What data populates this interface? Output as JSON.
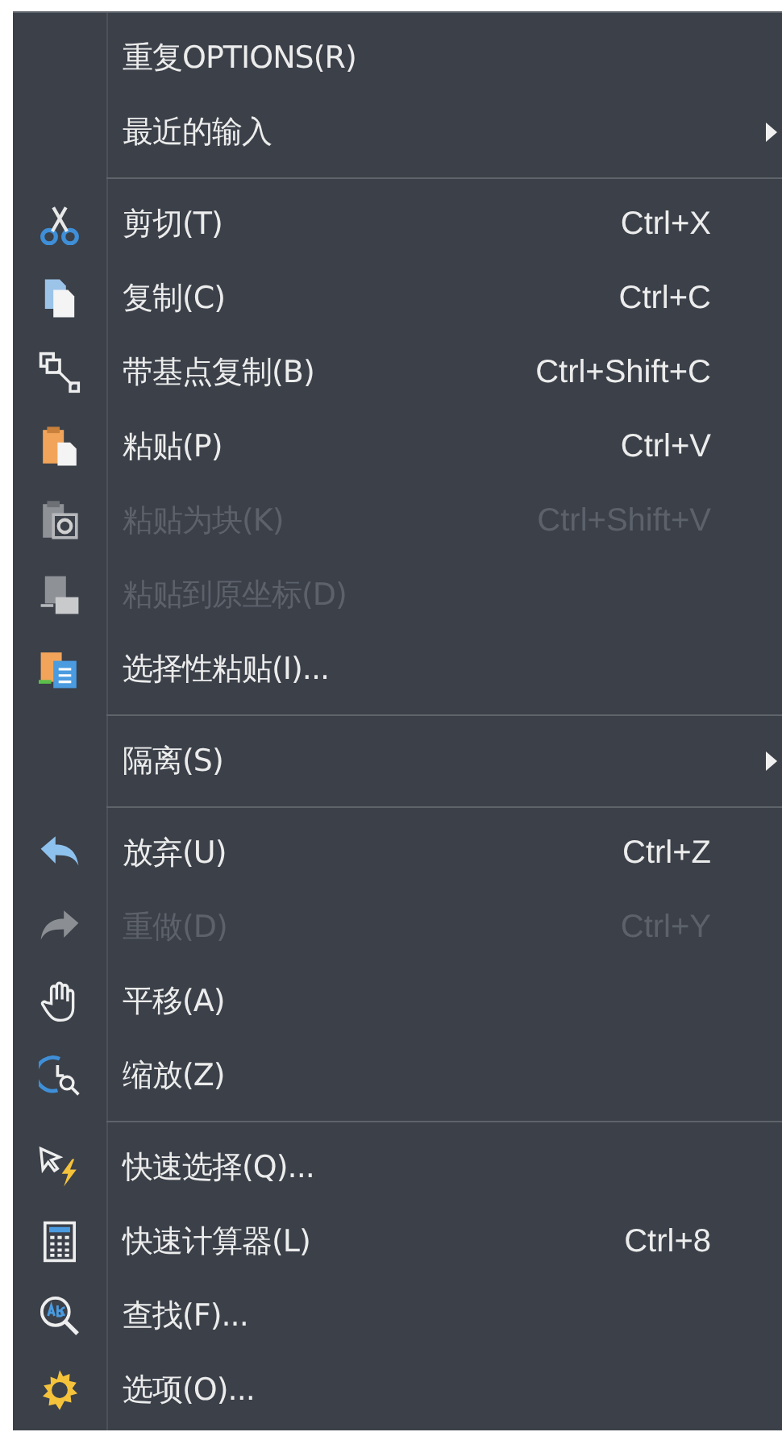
{
  "context_menu": {
    "sections": [
      {
        "items": [
          {
            "label": "重复OPTIONS(R)",
            "disabled": false,
            "submenu": false
          },
          {
            "label": "最近的输入",
            "disabled": false,
            "submenu": true
          }
        ]
      },
      {
        "items": [
          {
            "label": "剪切(T)",
            "shortcut": "Ctrl+X",
            "disabled": false,
            "submenu": false
          },
          {
            "label": "复制(C)",
            "shortcut": "Ctrl+C",
            "disabled": false,
            "submenu": false
          },
          {
            "label": "带基点复制(B)",
            "shortcut": "Ctrl+Shift+C",
            "disabled": false,
            "submenu": false
          },
          {
            "label": "粘贴(P)",
            "shortcut": "Ctrl+V",
            "disabled": false,
            "submenu": false
          },
          {
            "label": "粘贴为块(K)",
            "shortcut": "Ctrl+Shift+V",
            "disabled": true,
            "submenu": false
          },
          {
            "label": "粘贴到原坐标(D)",
            "disabled": true,
            "submenu": false
          },
          {
            "label": "选择性粘贴(I)...",
            "disabled": false,
            "submenu": false
          }
        ]
      },
      {
        "items": [
          {
            "label": "隔离(S)",
            "disabled": false,
            "submenu": true
          }
        ]
      },
      {
        "items": [
          {
            "label": "放弃(U)",
            "shortcut": "Ctrl+Z",
            "disabled": false,
            "submenu": false
          },
          {
            "label": "重做(D)",
            "shortcut": "Ctrl+Y",
            "disabled": true,
            "submenu": false
          },
          {
            "label": "平移(A)",
            "disabled": false,
            "submenu": false
          },
          {
            "label": "缩放(Z)",
            "disabled": false,
            "submenu": false
          }
        ]
      },
      {
        "items": [
          {
            "label": "快速选择(Q)...",
            "disabled": false,
            "submenu": false
          },
          {
            "label": "快速计算器(L)",
            "shortcut": "Ctrl+8",
            "disabled": false,
            "submenu": false
          },
          {
            "label": "查找(F)...",
            "disabled": false,
            "submenu": false
          },
          {
            "label": "选项(O)...",
            "disabled": false,
            "submenu": false
          }
        ]
      }
    ]
  }
}
